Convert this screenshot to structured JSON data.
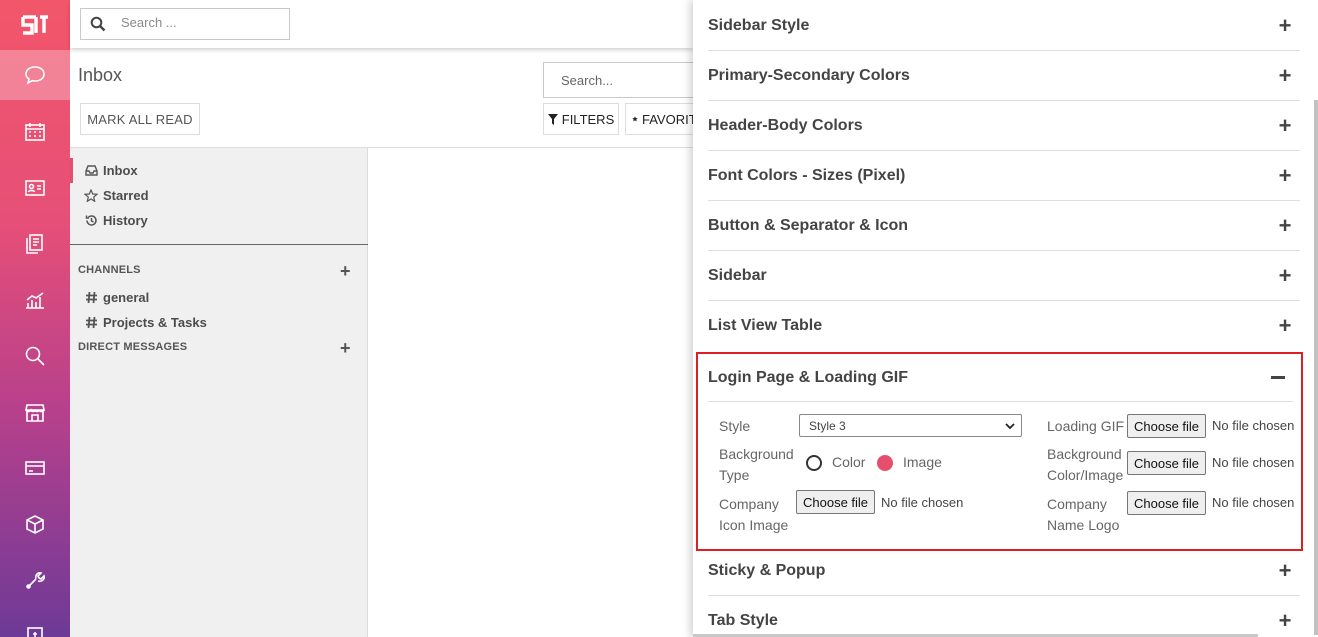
{
  "rail": {
    "icons": [
      "app-logo",
      "discuss-icon",
      "calendar-icon",
      "contacts-icon",
      "documents-icon",
      "reporting-icon",
      "search-icon",
      "store-icon",
      "payment-icon",
      "inventory-icon",
      "settings-icon",
      "invoicing-icon"
    ]
  },
  "topbar": {
    "search_placeholder": "Search ..."
  },
  "control": {
    "title": "Inbox",
    "mark_all_read": "MARK ALL READ",
    "search_placeholder": "Search...",
    "filters": "FILTERS",
    "favorites": "FAVORITES"
  },
  "sidebar": {
    "mailboxes": [
      {
        "label": "Inbox",
        "icon": "inbox-icon"
      },
      {
        "label": "Starred",
        "icon": "star-icon"
      },
      {
        "label": "History",
        "icon": "history-icon"
      }
    ],
    "channels_title": "CHANNELS",
    "channels": [
      {
        "label": "general",
        "icon": "hash-icon"
      },
      {
        "label": "Projects & Tasks",
        "icon": "hash-icon"
      }
    ],
    "dm_title": "DIRECT MESSAGES"
  },
  "panel": {
    "sections_top": [
      "Sidebar Style",
      "Primary-Secondary Colors",
      "Header-Body Colors",
      "Font Colors - Sizes (Pixel)",
      "Button & Separator & Icon",
      "Sidebar",
      "List View Table"
    ],
    "open_section": {
      "title": "Login Page & Loading GIF",
      "style_label": "Style",
      "style_value": "Style 3",
      "bg_type_label_1": "Background",
      "bg_type_label_2": "Type",
      "radio_color": "Color",
      "radio_image": "Image",
      "selected_radio": "Image",
      "company_icon_1": "Company",
      "company_icon_2": "Icon Image",
      "loading_gif": "Loading GIF",
      "bg_ci_1": "Background",
      "bg_ci_2": "Color/Image",
      "company_logo_1": "Company",
      "company_logo_2": "Name Logo",
      "choose_file": "Choose file",
      "no_file": "No file chosen"
    },
    "sections_bottom": [
      "Sticky & Popup",
      "Tab Style"
    ],
    "accent": "#e64f6c",
    "highlight_border": "#dc1f26"
  }
}
